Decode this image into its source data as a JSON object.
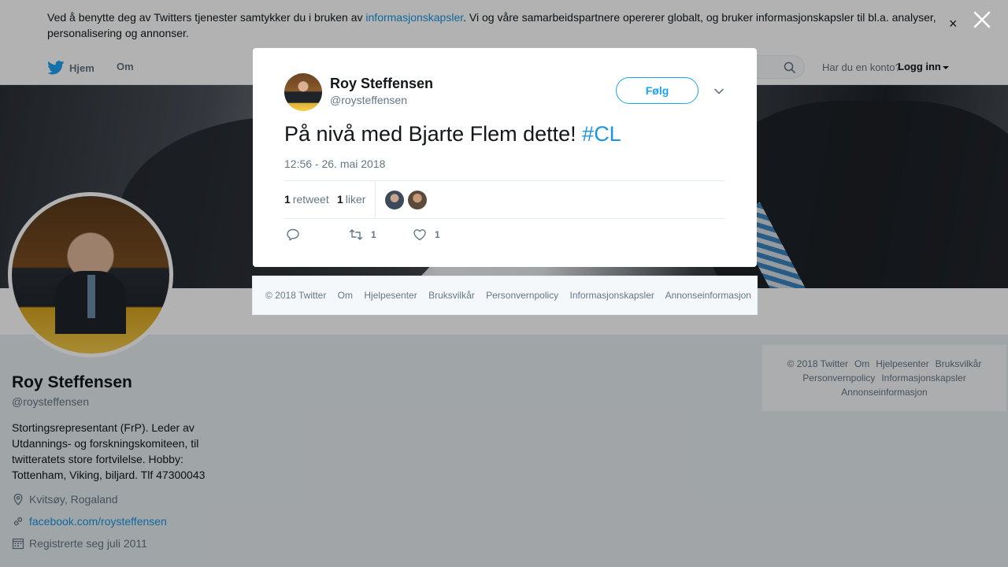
{
  "cookie_banner": {
    "text_before": "Ved å benytte deg av Twitters tjenester samtykker du i bruken av ",
    "link": "informasjonskapsler",
    "text_after": ". Vi og våre samarbeidspartnere opererer globalt, og bruker informasjonskapsler til bl.a. analyser, personalisering og annonser.",
    "close": "×"
  },
  "nav": {
    "home": "Hjem",
    "about": "Om",
    "account_prompt": "Har du en konto?",
    "login": "Logg inn"
  },
  "profile": {
    "name": "Roy Steffensen",
    "handle": "@roysteffensen",
    "bio": "Stortingsrepresentant (FrP). Leder av Utdannings- og forskningskomiteen, til twitteratets store fortvilelse. Hobby: Tottenham, Viking, biljard. Tlf 47300043",
    "location": "Kvitsøy, Rogaland",
    "url": "facebook.com/roysteffensen",
    "joined": "Registrerte seg juli 2011"
  },
  "tweet": {
    "name": "Roy Steffensen",
    "handle": "@roysteffensen",
    "follow_label": "Følg",
    "text": "På nivå med Bjarte Flem dette! ",
    "hashtag": "#CL",
    "timestamp": "12:56 - 26. mai 2018",
    "retweet_count": "1",
    "retweet_label": "retweet",
    "like_count": "1",
    "like_label": "liker",
    "action_retweet_count": "1",
    "action_like_count": "1"
  },
  "footer": {
    "copyright": "© 2018 Twitter",
    "links": [
      "Om",
      "Hjelpesenter",
      "Bruksvilkår",
      "Personvernpolicy",
      "Informasjonskapsler",
      "Annonseinformasjon"
    ]
  },
  "colors": {
    "accent": "#1da1f2",
    "link": "#1b95e0",
    "secondary_text": "#657786"
  }
}
